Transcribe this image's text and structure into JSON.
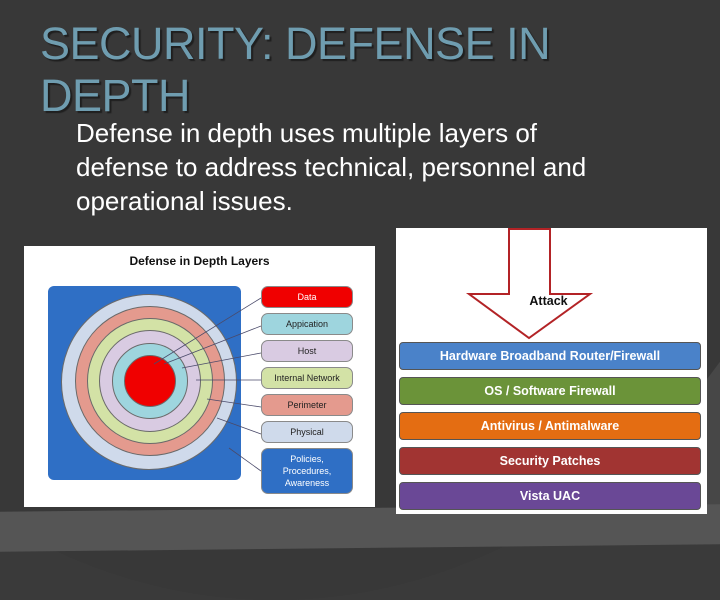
{
  "slide": {
    "title_lines": [
      "SECURITY: DEFENSE IN",
      "DEPTH"
    ],
    "body_lines": [
      "Defense in depth uses multiple layers of",
      "defense to address technical, personnel and",
      "operational issues."
    ]
  },
  "left_diagram": {
    "title": "Defense in Depth Layers",
    "layers": [
      {
        "label": "Data",
        "color": "#f00000"
      },
      {
        "label": "Appication",
        "color": "#9ed5de"
      },
      {
        "label": "Host",
        "color": "#d9cbe2"
      },
      {
        "label": "Internal Network",
        "color": "#d3e2a6"
      },
      {
        "label": "Perimeter",
        "color": "#e49a8e"
      },
      {
        "label": "Physical",
        "color": "#cfdaeb"
      },
      {
        "label": "Policies, Procedures, Awareness",
        "lines": [
          "Policies,",
          "Procedures,",
          "Awareness"
        ],
        "color": "#2f6fc5"
      }
    ]
  },
  "right_diagram": {
    "attack_label": "Attack",
    "layers": [
      {
        "label": "Hardware Broadband Router/Firewall",
        "color": "#4a82c9"
      },
      {
        "label": "OS / Software Firewall",
        "color": "#6b9339"
      },
      {
        "label": "Antivirus / Antimalware",
        "color": "#e46d12"
      },
      {
        "label": "Security Patches",
        "color": "#a13432"
      },
      {
        "label": "Vista UAC",
        "color": "#6a4896"
      }
    ]
  }
}
